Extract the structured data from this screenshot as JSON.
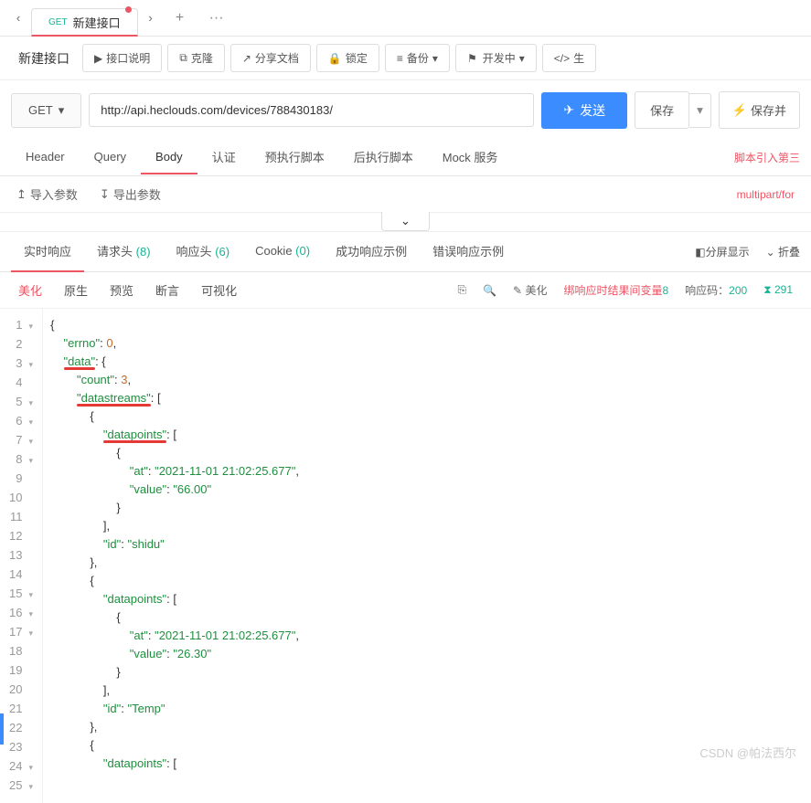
{
  "tab": {
    "method": "GET",
    "title": "新建接口"
  },
  "header": {
    "api_name": "新建接口"
  },
  "toolbar": {
    "desc": "接口说明",
    "clone": "克隆",
    "share": "分享文档",
    "lock": "锁定",
    "backup": "备份",
    "dev": "开发中",
    "gen": "生"
  },
  "request": {
    "method": "GET",
    "url": "http://api.heclouds.com/devices/788430183/",
    "send": "发送",
    "save": "保存",
    "save_and": "保存并"
  },
  "req_tabs": {
    "header": "Header",
    "query": "Query",
    "body": "Body",
    "auth": "认证",
    "pre": "预执行脚本",
    "post": "后执行脚本",
    "mock": "Mock 服务",
    "right": "脚本引入第三"
  },
  "io": {
    "import": "导入参数",
    "export": "导出参数",
    "right": "multipart/for"
  },
  "resp_tabs": {
    "realtime": "实时响应",
    "req_headers": "请求头",
    "req_headers_count": "(8)",
    "resp_headers": "响应头",
    "resp_headers_count": "(6)",
    "cookie": "Cookie",
    "cookie_count": "(0)",
    "success": "成功响应示例",
    "error": "错误响应示例",
    "split": "分屏显示",
    "fold": "折叠"
  },
  "view_tabs": {
    "pretty": "美化",
    "raw": "原生",
    "preview": "预览",
    "assert": "断言",
    "visual": "可视化"
  },
  "view_tools": {
    "beautify": "美化",
    "bind_left": "绑响应时结果间变量",
    "bind_right": "8",
    "code_label": "响应码：",
    "code_value": "200",
    "time": "291"
  },
  "code_lines": [
    {
      "n": 1,
      "fold": "▾",
      "indent": 0,
      "tokens": [
        {
          "t": "p",
          "v": "{"
        }
      ]
    },
    {
      "n": 2,
      "fold": "",
      "indent": 1,
      "tokens": [
        {
          "t": "k",
          "v": "\"errno\""
        },
        {
          "t": "p",
          "v": ": "
        },
        {
          "t": "n",
          "v": "0"
        },
        {
          "t": "p",
          "v": ","
        }
      ]
    },
    {
      "n": 3,
      "fold": "▾",
      "indent": 1,
      "tokens": [
        {
          "t": "k",
          "v": "\"data\"",
          "red": true
        },
        {
          "t": "p",
          "v": ": {"
        }
      ]
    },
    {
      "n": 4,
      "fold": "",
      "indent": 2,
      "tokens": [
        {
          "t": "k",
          "v": "\"count\""
        },
        {
          "t": "p",
          "v": ": "
        },
        {
          "t": "n",
          "v": "3"
        },
        {
          "t": "p",
          "v": ","
        }
      ]
    },
    {
      "n": 5,
      "fold": "▾",
      "indent": 2,
      "tokens": [
        {
          "t": "k",
          "v": "\"datastreams\"",
          "red": true
        },
        {
          "t": "p",
          "v": ": ["
        }
      ]
    },
    {
      "n": 6,
      "fold": "▾",
      "indent": 3,
      "tokens": [
        {
          "t": "p",
          "v": "{"
        }
      ]
    },
    {
      "n": 7,
      "fold": "▾",
      "indent": 4,
      "tokens": [
        {
          "t": "k",
          "v": "\"datapoints\"",
          "red": true
        },
        {
          "t": "p",
          "v": ": ["
        }
      ]
    },
    {
      "n": 8,
      "fold": "▾",
      "indent": 5,
      "tokens": [
        {
          "t": "p",
          "v": "{"
        }
      ]
    },
    {
      "n": 9,
      "fold": "",
      "indent": 6,
      "tokens": [
        {
          "t": "k",
          "v": "\"at\""
        },
        {
          "t": "p",
          "v": ": "
        },
        {
          "t": "s",
          "v": "\"2021-11-01 21:02:25.677\""
        },
        {
          "t": "p",
          "v": ","
        }
      ]
    },
    {
      "n": 10,
      "fold": "",
      "indent": 6,
      "tokens": [
        {
          "t": "k",
          "v": "\"value\""
        },
        {
          "t": "p",
          "v": ": "
        },
        {
          "t": "s",
          "v": "\"66.00\""
        }
      ]
    },
    {
      "n": 11,
      "fold": "",
      "indent": 5,
      "tokens": [
        {
          "t": "p",
          "v": "}"
        }
      ]
    },
    {
      "n": 12,
      "fold": "",
      "indent": 4,
      "tokens": [
        {
          "t": "p",
          "v": "],"
        }
      ]
    },
    {
      "n": 13,
      "fold": "",
      "indent": 4,
      "tokens": [
        {
          "t": "k",
          "v": "\"id\""
        },
        {
          "t": "p",
          "v": ": "
        },
        {
          "t": "s",
          "v": "\"shidu\""
        }
      ]
    },
    {
      "n": 14,
      "fold": "",
      "indent": 3,
      "tokens": [
        {
          "t": "p",
          "v": "},"
        }
      ]
    },
    {
      "n": 15,
      "fold": "▾",
      "indent": 3,
      "tokens": [
        {
          "t": "p",
          "v": "{"
        }
      ]
    },
    {
      "n": 16,
      "fold": "▾",
      "indent": 4,
      "tokens": [
        {
          "t": "k",
          "v": "\"datapoints\""
        },
        {
          "t": "p",
          "v": ": ["
        }
      ]
    },
    {
      "n": 17,
      "fold": "▾",
      "indent": 5,
      "tokens": [
        {
          "t": "p",
          "v": "{"
        }
      ]
    },
    {
      "n": 18,
      "fold": "",
      "indent": 6,
      "tokens": [
        {
          "t": "k",
          "v": "\"at\""
        },
        {
          "t": "p",
          "v": ": "
        },
        {
          "t": "s",
          "v": "\"2021-11-01 21:02:25.677\""
        },
        {
          "t": "p",
          "v": ","
        }
      ]
    },
    {
      "n": 19,
      "fold": "",
      "indent": 6,
      "tokens": [
        {
          "t": "k",
          "v": "\"value\""
        },
        {
          "t": "p",
          "v": ": "
        },
        {
          "t": "s",
          "v": "\"26.30\""
        }
      ]
    },
    {
      "n": 20,
      "fold": "",
      "indent": 5,
      "tokens": [
        {
          "t": "p",
          "v": "}"
        }
      ]
    },
    {
      "n": 21,
      "fold": "",
      "indent": 4,
      "tokens": [
        {
          "t": "p",
          "v": "],"
        }
      ]
    },
    {
      "n": 22,
      "fold": "",
      "indent": 4,
      "tokens": [
        {
          "t": "k",
          "v": "\"id\""
        },
        {
          "t": "p",
          "v": ": "
        },
        {
          "t": "s",
          "v": "\"Temp\""
        }
      ]
    },
    {
      "n": 23,
      "fold": "",
      "indent": 3,
      "tokens": [
        {
          "t": "p",
          "v": "},"
        }
      ]
    },
    {
      "n": 24,
      "fold": "▾",
      "indent": 3,
      "tokens": [
        {
          "t": "p",
          "v": "{"
        }
      ]
    },
    {
      "n": 25,
      "fold": "▾",
      "indent": 4,
      "tokens": [
        {
          "t": "k",
          "v": "\"datapoints\""
        },
        {
          "t": "p",
          "v": ": ["
        }
      ]
    }
  ],
  "watermark": "CSDN @帕法西尔"
}
